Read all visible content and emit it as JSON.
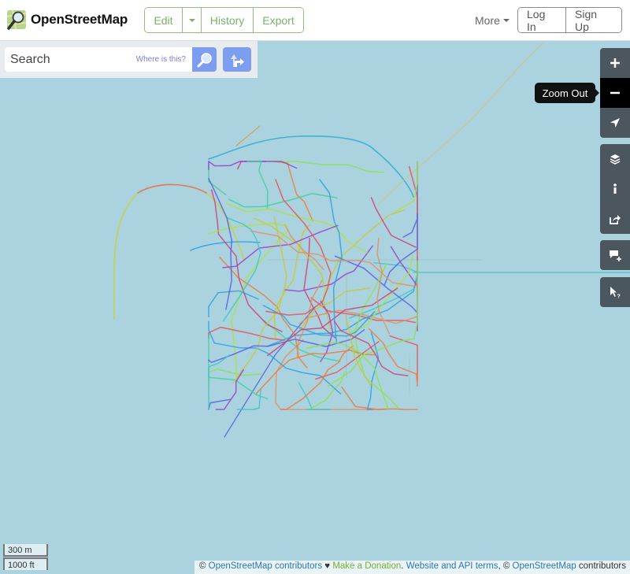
{
  "header": {
    "brand": "OpenStreetMap",
    "edit_label": "Edit",
    "history_label": "History",
    "export_label": "Export",
    "more_label": "More",
    "login_label": "Log In",
    "signup_label": "Sign Up"
  },
  "search": {
    "placeholder": "Search",
    "where_label": "Where is this?"
  },
  "controls": {
    "tooltip": "Zoom Out",
    "items": [
      "zoom-in",
      "zoom-out",
      "locate",
      "layers",
      "map-data",
      "share",
      "add-note",
      "query-features"
    ]
  },
  "scale": {
    "metric": "300 m",
    "imperial": "1000 ft"
  },
  "attribution": {
    "copy1": "©",
    "osm1": "OpenStreetMap contributors",
    "heart": "♥",
    "donate": "Make a Donation",
    "dot": ".",
    "terms": "Website and API terms",
    "comma": ", ©",
    "osm2": "OpenStreetMap",
    "contributors": " contributors"
  },
  "colors": {
    "map_bg": "#aad3df",
    "edit_green": "#7ab266",
    "search_blue": "#7c9df0",
    "control_bg": "#4c565f",
    "link_blue": "#2277bb",
    "donate_green": "#71b035"
  },
  "tracks": {
    "palette": [
      "#e8505a",
      "#f07a3c",
      "#c8c83c",
      "#8ee050",
      "#3cc8c8",
      "#30a0e0",
      "#5a60e0",
      "#9a40d0",
      "#d0407a",
      "#e09060",
      "#b0e040",
      "#40d0a0"
    ]
  }
}
